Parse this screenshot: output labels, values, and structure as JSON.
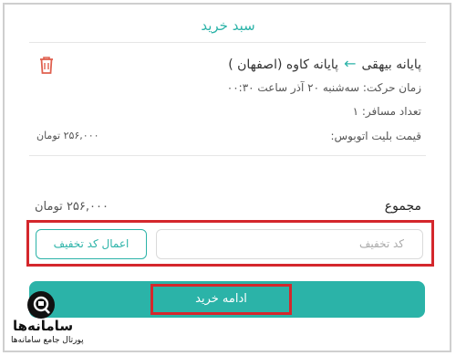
{
  "header": {
    "title": "سبد خرید"
  },
  "trip": {
    "origin": "پایانه بیهقی",
    "destination": "پایانه کاوه (اصفهان )",
    "departure": "زمان حرکت: سه‌شنبه ۲۰ آذر ساعت ۰۰:۳۰",
    "passengers": "تعداد مسافر: ۱",
    "ticket_price_label": "قیمت بلیت اتوبوس:",
    "ticket_price_value": "۲۵۶,۰۰۰ تومان"
  },
  "total": {
    "label": "مجموع",
    "value": "۲۵۶,۰۰۰ تومان"
  },
  "discount": {
    "placeholder": "کد تخفیف",
    "apply_label": "اعمال کد تخفیف"
  },
  "continue": {
    "label": "ادامه خرید"
  },
  "watermark": {
    "name": "سامانه‌ها",
    "tagline": "پورتال جامع سامانه‌ها"
  },
  "colors": {
    "accent": "#2bb3a8",
    "highlight": "#d4272c",
    "trash": "#e0604f"
  }
}
